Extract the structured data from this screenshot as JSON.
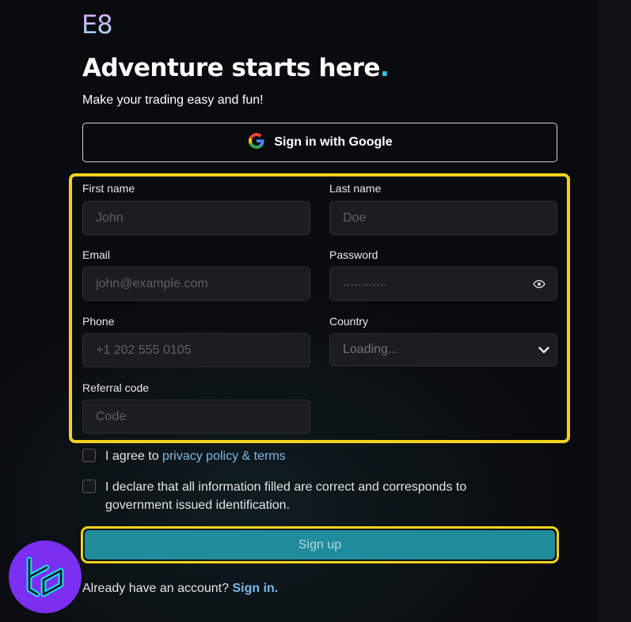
{
  "brand": {
    "logo_text": "E8"
  },
  "header": {
    "title": "Adventure starts here",
    "title_dot": ".",
    "subtitle": "Make your trading easy and fun!"
  },
  "google": {
    "label": "Sign in with Google",
    "icon": "google-icon"
  },
  "form": {
    "first_name": {
      "label": "First name",
      "placeholder": "John"
    },
    "last_name": {
      "label": "Last name",
      "placeholder": "Doe"
    },
    "email": {
      "label": "Email",
      "placeholder": "john@example.com"
    },
    "password": {
      "label": "Password",
      "placeholder": "············",
      "icon": "eye-icon"
    },
    "phone": {
      "label": "Phone",
      "placeholder": "+1 202 555 0105"
    },
    "country": {
      "label": "Country",
      "value": "Loading...",
      "icon": "chevron-down-icon"
    },
    "referral": {
      "label": "Referral code",
      "placeholder": "Code"
    }
  },
  "agreements": {
    "terms_prefix": "I agree to ",
    "terms_link": "privacy policy & terms",
    "declaration": "I declare that all information filled are correct and corresponds to government issued identification."
  },
  "signup": {
    "label": "Sign up"
  },
  "footer": {
    "prompt": "Already have an account? ",
    "signin_link": "Sign in."
  },
  "colors": {
    "accent": "#1f8c9c",
    "highlight": "#f2d31b",
    "link": "#7ab8e8",
    "dot": "#2fc7e6",
    "badge": "#7b2ff0"
  },
  "watermark": {
    "icon": "tc-logo-icon"
  }
}
